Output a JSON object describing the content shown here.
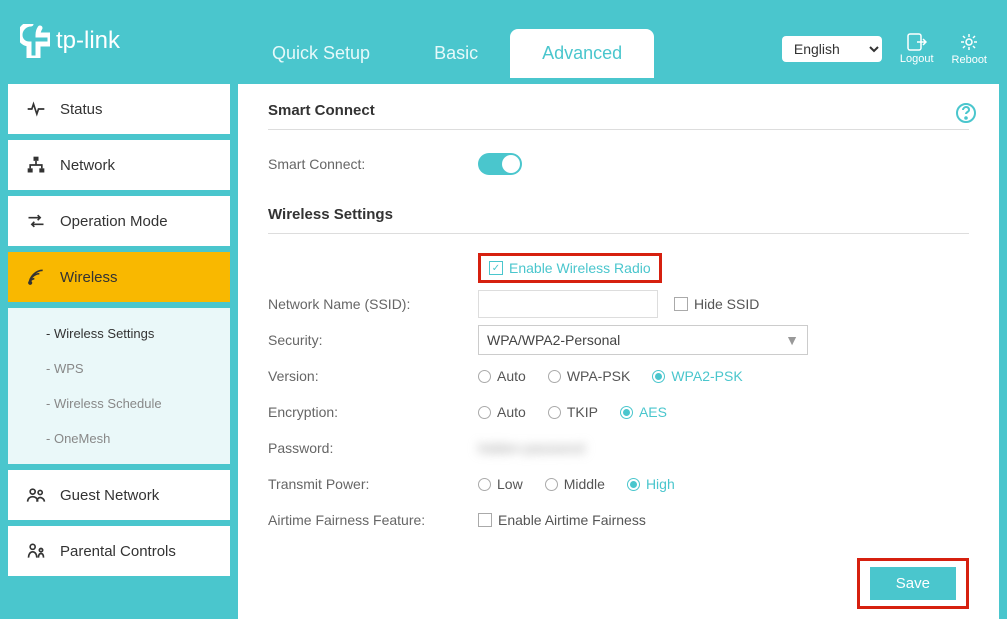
{
  "header": {
    "brand": "tp-link",
    "tabs": [
      "Quick Setup",
      "Basic",
      "Advanced"
    ],
    "active_tab": "Advanced",
    "language": "English",
    "logout": "Logout",
    "reboot": "Reboot"
  },
  "sidebar": {
    "items": [
      "Status",
      "Network",
      "Operation Mode",
      "Wireless",
      "Guest Network",
      "Parental Controls"
    ],
    "active": "Wireless",
    "sub_items": [
      "Wireless Settings",
      "WPS",
      "Wireless Schedule",
      "OneMesh"
    ],
    "sub_active": "Wireless Settings"
  },
  "main": {
    "section1_title": "Smart Connect",
    "smart_connect_label": "Smart Connect:",
    "section2_title": "Wireless Settings",
    "enable_radio_label": "Enable Wireless Radio",
    "ssid_label": "Network Name (SSID):",
    "ssid_value": "",
    "hide_ssid_label": "Hide SSID",
    "security_label": "Security:",
    "security_value": "WPA/WPA2-Personal",
    "version_label": "Version:",
    "version_options": [
      "Auto",
      "WPA-PSK",
      "WPA2-PSK"
    ],
    "version_selected": "WPA2-PSK",
    "encryption_label": "Encryption:",
    "encryption_options": [
      "Auto",
      "TKIP",
      "AES"
    ],
    "encryption_selected": "AES",
    "password_label": "Password:",
    "password_value": "hidden-password",
    "power_label": "Transmit Power:",
    "power_options": [
      "Low",
      "Middle",
      "High"
    ],
    "power_selected": "High",
    "airtime_label": "Airtime Fairness Feature:",
    "airtime_checkbox": "Enable Airtime Fairness",
    "save_button": "Save"
  }
}
